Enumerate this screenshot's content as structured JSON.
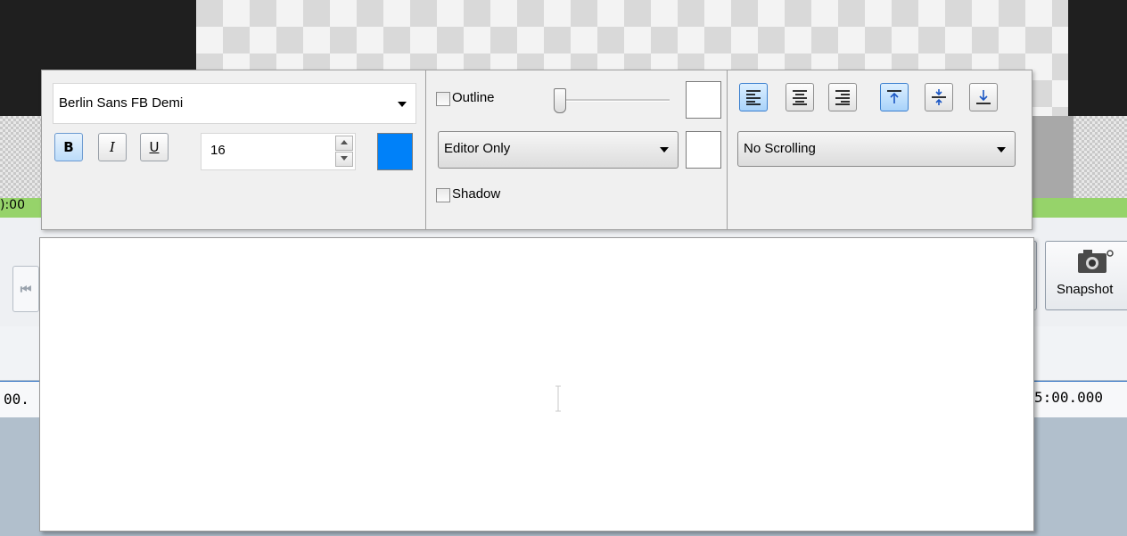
{
  "background": {
    "timecode_top_left": "):00",
    "timecode_bottom_left": "00.",
    "timecode_bottom_right": "5:00.000",
    "snapshot_label": "Snapshot",
    "snapshot_icon": "camera-icon",
    "colors": {
      "green_bar": "#96d36a",
      "timeline_line": "#2c6fc2"
    }
  },
  "format_toolbar": {
    "font_name": "Berlin Sans FB Demi",
    "bold_label": "B",
    "italic_label": "I",
    "underline_label": "U",
    "bold_active": true,
    "font_size": "16",
    "font_color": "#0081f9",
    "outline_label": "Outline",
    "outline_checked": false,
    "outline_width_fraction": 0,
    "outline_color": "#ffffff",
    "mode_value": "Editor Only",
    "shadow_color": "#ffffff",
    "shadow_label": "Shadow",
    "shadow_checked": false,
    "align_left_active": true,
    "valign_top_active": true,
    "scrolling_value": "No Scrolling"
  },
  "editor": {
    "text": ""
  }
}
